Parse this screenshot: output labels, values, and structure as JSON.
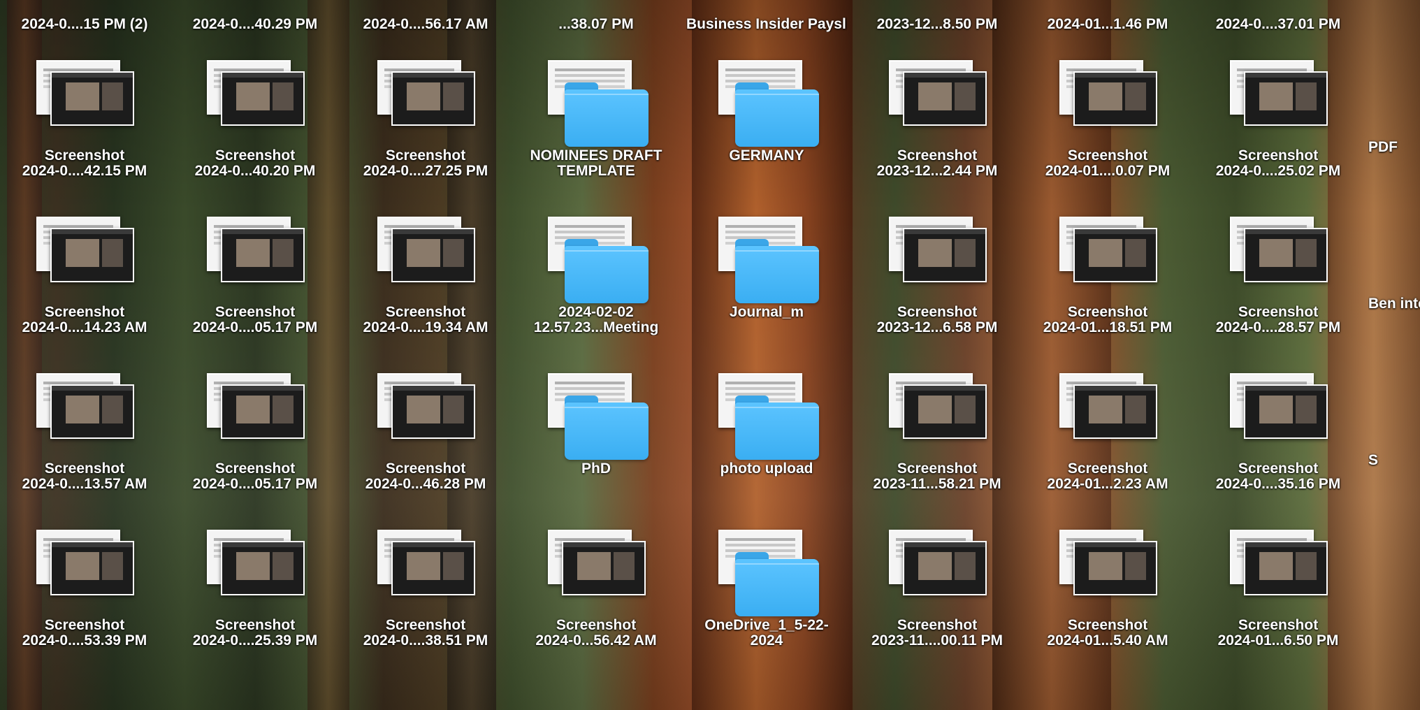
{
  "desktop": {
    "rows": [
      [
        {
          "kind": "screenshot",
          "line1": "Screenshot",
          "line2": "2024-0....42.15 PM"
        },
        {
          "kind": "screenshot",
          "line1": "Screenshot",
          "line2": "2024-0...40.20 PM"
        },
        {
          "kind": "screenshot",
          "line1": "Screenshot",
          "line2": "2024-0....27.25 PM"
        },
        {
          "kind": "folder",
          "line1": "NOMINEES DRAFT",
          "line2": "TEMPLATE"
        },
        {
          "kind": "folder",
          "line1": "GERMANY",
          "line2": ""
        },
        {
          "kind": "screenshot",
          "line1": "Screenshot",
          "line2": "2023-12...2.44 PM"
        },
        {
          "kind": "screenshot",
          "line1": "Screenshot",
          "line2": "2024-01....0.07 PM"
        },
        {
          "kind": "screenshot",
          "line1": "Screenshot",
          "line2": "2024-0....25.02 PM"
        }
      ],
      [
        {
          "kind": "screenshot",
          "line1": "Screenshot",
          "line2": "2024-0....14.23 AM"
        },
        {
          "kind": "screenshot",
          "line1": "Screenshot",
          "line2": "2024-0....05.17 PM"
        },
        {
          "kind": "screenshot",
          "line1": "Screenshot",
          "line2": "2024-0....19.34 AM"
        },
        {
          "kind": "folder",
          "line1": "2024-02-02",
          "line2": "12.57.23...Meeting"
        },
        {
          "kind": "folder",
          "line1": "Journal_m",
          "line2": ""
        },
        {
          "kind": "screenshot",
          "line1": "Screenshot",
          "line2": "2023-12...6.58 PM"
        },
        {
          "kind": "screenshot",
          "line1": "Screenshot",
          "line2": "2024-01...18.51 PM"
        },
        {
          "kind": "screenshot",
          "line1": "Screenshot",
          "line2": "2024-0....28.57 PM"
        }
      ],
      [
        {
          "kind": "screenshot",
          "line1": "Screenshot",
          "line2": "2024-0....13.57 AM"
        },
        {
          "kind": "screenshot",
          "line1": "Screenshot",
          "line2": "2024-0....05.17 PM"
        },
        {
          "kind": "screenshot",
          "line1": "Screenshot",
          "line2": "2024-0...46.28 PM"
        },
        {
          "kind": "folder",
          "line1": "PhD",
          "line2": ""
        },
        {
          "kind": "folder",
          "line1": "photo upload",
          "line2": ""
        },
        {
          "kind": "screenshot",
          "line1": "Screenshot",
          "line2": "2023-11...58.21 PM"
        },
        {
          "kind": "screenshot",
          "line1": "Screenshot",
          "line2": "2024-01...2.23 AM"
        },
        {
          "kind": "screenshot",
          "line1": "Screenshot",
          "line2": "2024-0....35.16 PM"
        }
      ],
      [
        {
          "kind": "screenshot",
          "line1": "Screenshot",
          "line2": "2024-0....53.39 PM"
        },
        {
          "kind": "screenshot",
          "line1": "Screenshot",
          "line2": "2024-0....25.39 PM"
        },
        {
          "kind": "screenshot",
          "line1": "Screenshot",
          "line2": "2024-0....38.51 PM"
        },
        {
          "kind": "screenshot",
          "line1": "Screenshot",
          "line2": "2024-0...56.42 AM"
        },
        {
          "kind": "folder",
          "line1": "OneDrive_1_5-22-",
          "line2": "2024"
        },
        {
          "kind": "screenshot",
          "line1": "Screenshot",
          "line2": "2023-11....00.11 PM"
        },
        {
          "kind": "screenshot",
          "line1": "Screenshot",
          "line2": "2024-01...5.40 AM"
        },
        {
          "kind": "screenshot",
          "line1": "Screenshot",
          "line2": "2024-01...6.50 PM"
        }
      ]
    ],
    "top_partial": [
      "2024-0....15 PM (2)",
      "2024-0....40.29 PM",
      "2024-0....56.17 AM",
      "...38.07 PM",
      "Business Insider Payslips",
      "2023-12...8.50 PM",
      "2024-01...1.46 PM",
      "2024-0....37.01 PM"
    ],
    "right_partial": [
      "PDF",
      "Ben inte",
      "S"
    ]
  }
}
